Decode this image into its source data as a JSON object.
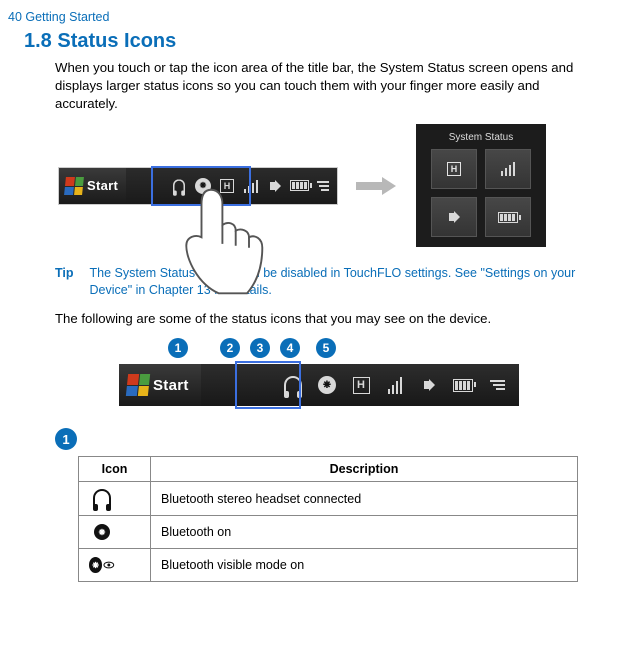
{
  "pageHeader": "40  Getting Started",
  "heading": "1.8 Status Icons",
  "intro": "When you touch or tap the icon area of the title bar, the System Status screen opens and displays larger status icons so you can touch them with your finger more easily and accurately.",
  "startLabel": "Start",
  "systemStatusTitle": "System Status",
  "tiles": {
    "h": "H"
  },
  "tip": {
    "label": "Tip",
    "text": "The System Status screen can be disabled in TouchFLO settings. See \"Settings on your Device\" in Chapter 13 for details."
  },
  "followingText": "The following are some of the status icons that you may see on the device.",
  "callouts": [
    "1",
    "2",
    "3",
    "4",
    "5"
  ],
  "sectionBadge": "1",
  "table": {
    "headers": {
      "icon": "Icon",
      "desc": "Description"
    },
    "rows": [
      {
        "desc": "Bluetooth stereo headset connected"
      },
      {
        "desc": "Bluetooth on"
      },
      {
        "desc": "Bluetooth visible mode on"
      }
    ]
  }
}
